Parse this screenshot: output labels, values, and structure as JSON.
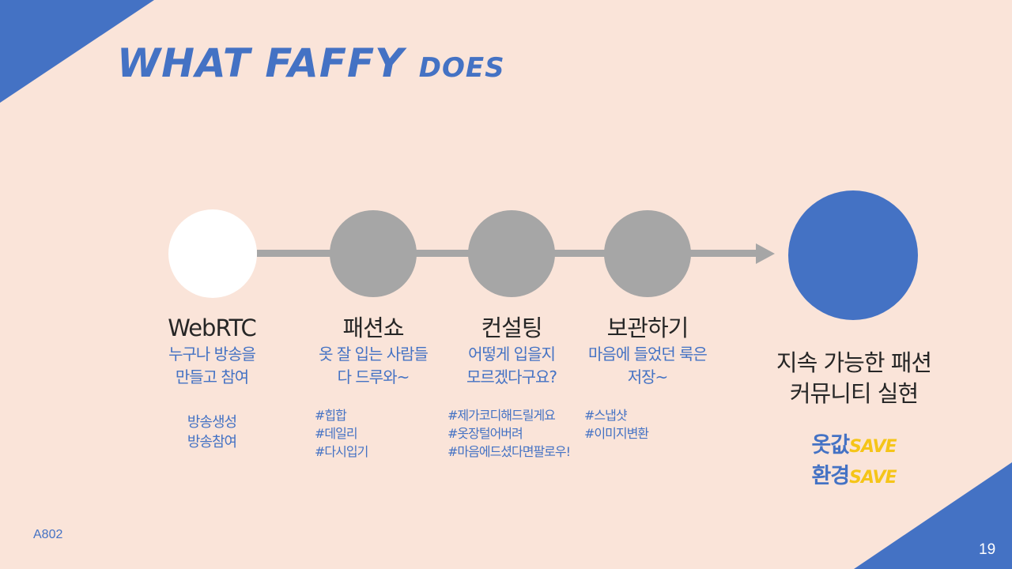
{
  "title": {
    "main": "WHAT FAFFY ",
    "small": "DOES"
  },
  "steps": [
    {
      "title": "WebRTC",
      "sub1": "누구나 방송을",
      "sub2": "만들고 참여",
      "tags": [
        "방송생성",
        "방송참여"
      ]
    },
    {
      "title": "패션쇼",
      "sub1": "옷 잘 입는 사람들",
      "sub2": "다 드루와~",
      "tags": [
        "#힙합",
        "#데일리",
        "#다시입기"
      ]
    },
    {
      "title": "컨설팅",
      "sub1": "어떻게 입을지",
      "sub2": "모르겠다구요?",
      "tags": [
        "#제가코디해드릴게요",
        "#옷장털어버려",
        "#마음에드셨다면팔로우!"
      ]
    },
    {
      "title": "보관하기",
      "sub1": "마음에 들었던 룩은",
      "sub2": "저장~",
      "tags": [
        "#스냅샷",
        "#이미지변환"
      ]
    }
  ],
  "goal": {
    "line1": "지속 가능한 패션",
    "line2": "커뮤니티 실현"
  },
  "save": [
    {
      "label": "옷값",
      "word": "SAVE"
    },
    {
      "label": "환경",
      "word": "SAVE"
    }
  ],
  "footer": {
    "code": "A802",
    "page": "19"
  },
  "colors": {
    "background": "#fae4d9",
    "accent": "#4472c4",
    "gray": "#a6a6a6",
    "yellow": "#f5c518"
  }
}
